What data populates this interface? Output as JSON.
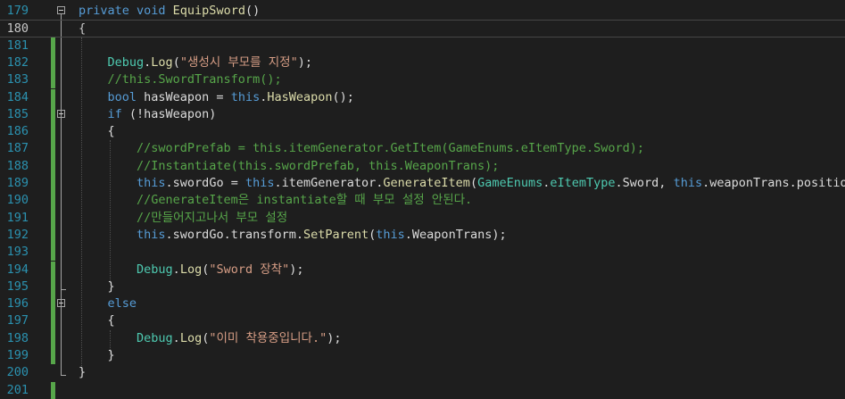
{
  "editor": {
    "lines": [
      {
        "num": "179",
        "tokens": [
          [
            "kw",
            "private void "
          ],
          [
            "fn",
            "EquipSword"
          ],
          [
            "pl",
            "()"
          ]
        ]
      },
      {
        "num": "180",
        "tokens": [
          [
            "pl",
            "{"
          ]
        ]
      },
      {
        "num": "181",
        "tokens": []
      },
      {
        "num": "182",
        "tokens": [
          [
            "ty",
            "    Debug"
          ],
          [
            "pl",
            "."
          ],
          [
            "fn",
            "Log"
          ],
          [
            "pl",
            "("
          ],
          [
            "st",
            "\"생성시 부모를 지정\""
          ],
          [
            "pl",
            ");"
          ]
        ]
      },
      {
        "num": "183",
        "tokens": [
          [
            "cm",
            "    //this.SwordTransform();"
          ]
        ]
      },
      {
        "num": "184",
        "tokens": [
          [
            "kw",
            "    bool "
          ],
          [
            "pl",
            "hasWeapon = "
          ],
          [
            "kw",
            "this"
          ],
          [
            "pl",
            "."
          ],
          [
            "fn",
            "HasWeapon"
          ],
          [
            "pl",
            "();"
          ]
        ]
      },
      {
        "num": "185",
        "tokens": [
          [
            "kw",
            "    if "
          ],
          [
            "pl",
            "(!hasWeapon)"
          ]
        ]
      },
      {
        "num": "186",
        "tokens": [
          [
            "pl",
            "    {"
          ]
        ]
      },
      {
        "num": "187",
        "tokens": [
          [
            "cm",
            "        //swordPrefab = this.itemGenerator.GetItem(GameEnums.eItemType.Sword);"
          ]
        ]
      },
      {
        "num": "188",
        "tokens": [
          [
            "cm",
            "        //Instantiate(this.swordPrefab, this.WeaponTrans);"
          ]
        ]
      },
      {
        "num": "189",
        "tokens": [
          [
            "kw",
            "        this"
          ],
          [
            "pl",
            ".swordGo = "
          ],
          [
            "kw",
            "this"
          ],
          [
            "pl",
            ".itemGenerator."
          ],
          [
            "fn",
            "GenerateItem"
          ],
          [
            "pl",
            "("
          ],
          [
            "ty",
            "GameEnums"
          ],
          [
            "pl",
            "."
          ],
          [
            "ty",
            "eItemType"
          ],
          [
            "pl",
            ".Sword, "
          ],
          [
            "kw",
            "this"
          ],
          [
            "pl",
            ".weaponTrans.position);"
          ]
        ]
      },
      {
        "num": "190",
        "tokens": [
          [
            "cm",
            "        //GenerateItem은 instantiate할 때 부모 설정 안된다."
          ]
        ]
      },
      {
        "num": "191",
        "tokens": [
          [
            "cm",
            "        //만들어지고나서 부모 설정"
          ]
        ]
      },
      {
        "num": "192",
        "tokens": [
          [
            "kw",
            "        this"
          ],
          [
            "pl",
            ".swordGo.transform."
          ],
          [
            "fn",
            "SetParent"
          ],
          [
            "pl",
            "("
          ],
          [
            "kw",
            "this"
          ],
          [
            "pl",
            ".WeaponTrans);"
          ]
        ]
      },
      {
        "num": "193",
        "tokens": []
      },
      {
        "num": "194",
        "tokens": [
          [
            "ty",
            "        Debug"
          ],
          [
            "pl",
            "."
          ],
          [
            "fn",
            "Log"
          ],
          [
            "pl",
            "("
          ],
          [
            "st",
            "\"Sword 장착\""
          ],
          [
            "pl",
            ");"
          ]
        ]
      },
      {
        "num": "195",
        "tokens": [
          [
            "pl",
            "    }"
          ]
        ]
      },
      {
        "num": "196",
        "tokens": [
          [
            "kw",
            "    else"
          ]
        ]
      },
      {
        "num": "197",
        "tokens": [
          [
            "pl",
            "    {"
          ]
        ]
      },
      {
        "num": "198",
        "tokens": [
          [
            "ty",
            "        Debug"
          ],
          [
            "pl",
            "."
          ],
          [
            "fn",
            "Log"
          ],
          [
            "pl",
            "("
          ],
          [
            "st",
            "\"이미 착용중입니다.\""
          ],
          [
            "pl",
            ");"
          ]
        ]
      },
      {
        "num": "199",
        "tokens": [
          [
            "pl",
            "    }"
          ]
        ]
      },
      {
        "num": "200",
        "tokens": [
          [
            "pl",
            "}"
          ]
        ]
      },
      {
        "num": "201",
        "tokens": []
      }
    ],
    "current_line": "180",
    "modified_lines": [
      "181",
      "182",
      "183",
      "184",
      "185",
      "186",
      "187",
      "188",
      "189",
      "190",
      "191",
      "192",
      "193",
      "194",
      "195",
      "196",
      "197",
      "198",
      "199",
      "201"
    ],
    "fold_markers": [
      "179",
      "185",
      "196"
    ],
    "colors": {
      "background": "#1e1e1e",
      "keyword": "#569cd6",
      "comment": "#57a64a",
      "string": "#d69d85",
      "type": "#4ec9b0",
      "method": "#dcdcaa",
      "plain": "#dcdcdc",
      "line_number": "#2b91af",
      "change_bar": "#57a64a"
    }
  }
}
